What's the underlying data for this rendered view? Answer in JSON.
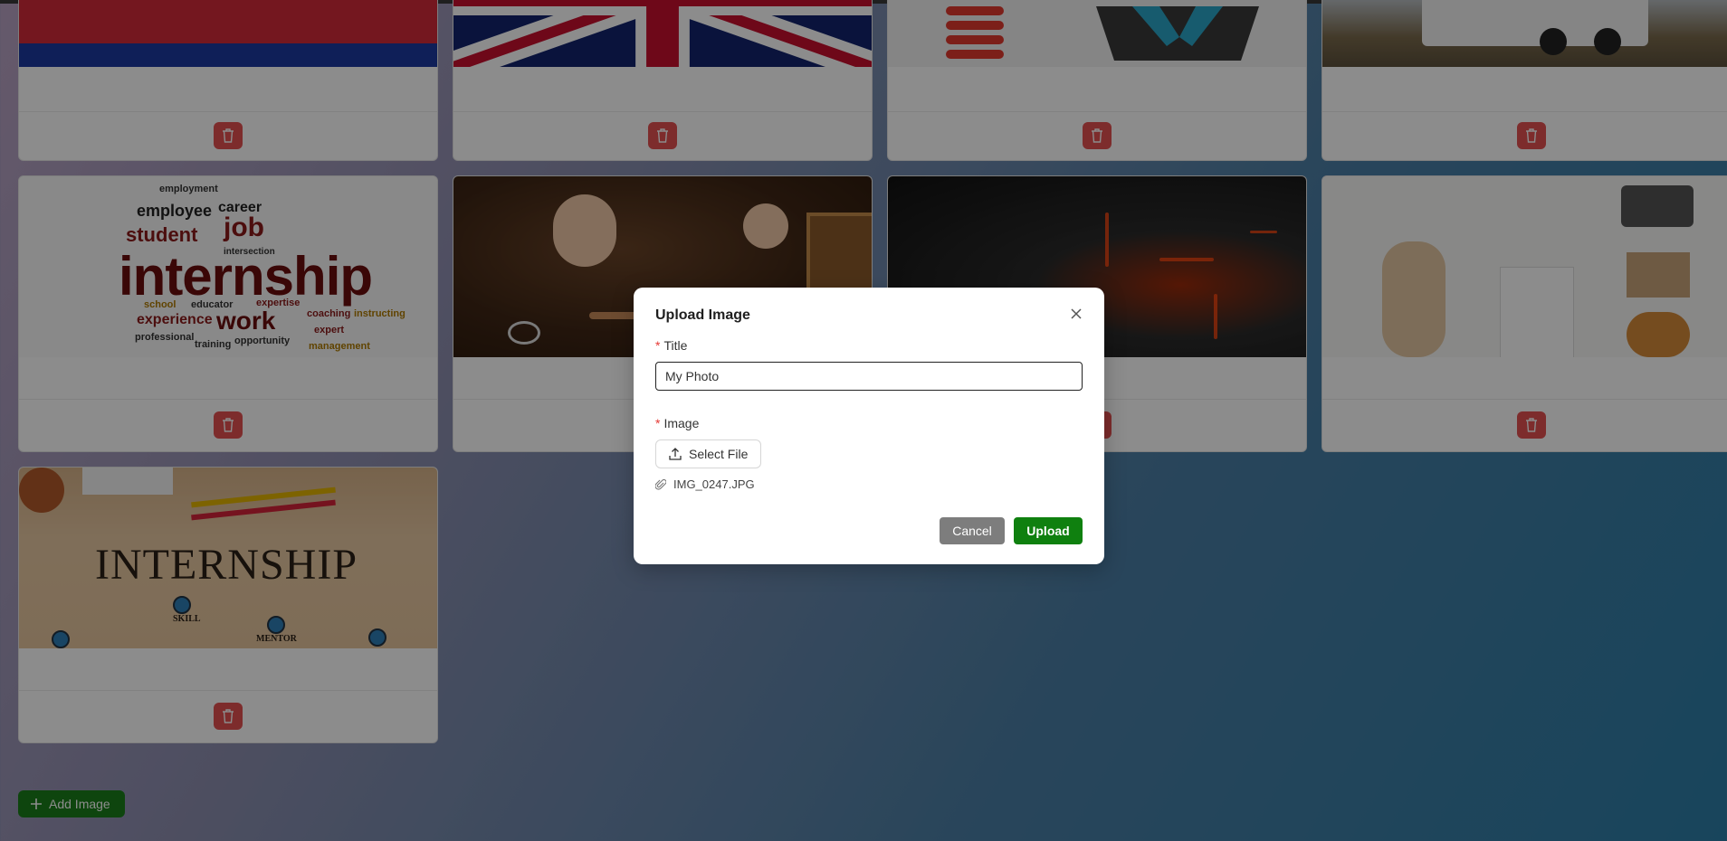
{
  "gallery": {
    "delete_icon": "trash-icon",
    "cards": [
      {
        "image": "cambodia-flag"
      },
      {
        "image": "uk-flag"
      },
      {
        "image": "logo-graphic"
      },
      {
        "image": "truck-photo"
      },
      {
        "image": "internship-word-cloud"
      },
      {
        "image": "hands-crafting-photo"
      },
      {
        "image": "lava-texture-photo"
      },
      {
        "image": "flat-lay-photo"
      },
      {
        "image": "internship-board-photo"
      }
    ],
    "word_cloud_text": "internship",
    "board_text": "INTERNSHIP",
    "board_nodes": [
      "SKILL",
      "MENTOR"
    ]
  },
  "add_button": {
    "label": "Add Image",
    "icon": "plus-icon",
    "color": "#1a7f1a"
  },
  "modal": {
    "title": "Upload Image",
    "title_label": "Title",
    "title_value": "My Photo",
    "image_label": "Image",
    "select_file_label": "Select File",
    "file_name": "IMG_0247.JPG",
    "cancel_label": "Cancel",
    "upload_label": "Upload",
    "required_marker": "*",
    "upload_color": "#0f800f",
    "cancel_color": "#7d7d7d"
  }
}
